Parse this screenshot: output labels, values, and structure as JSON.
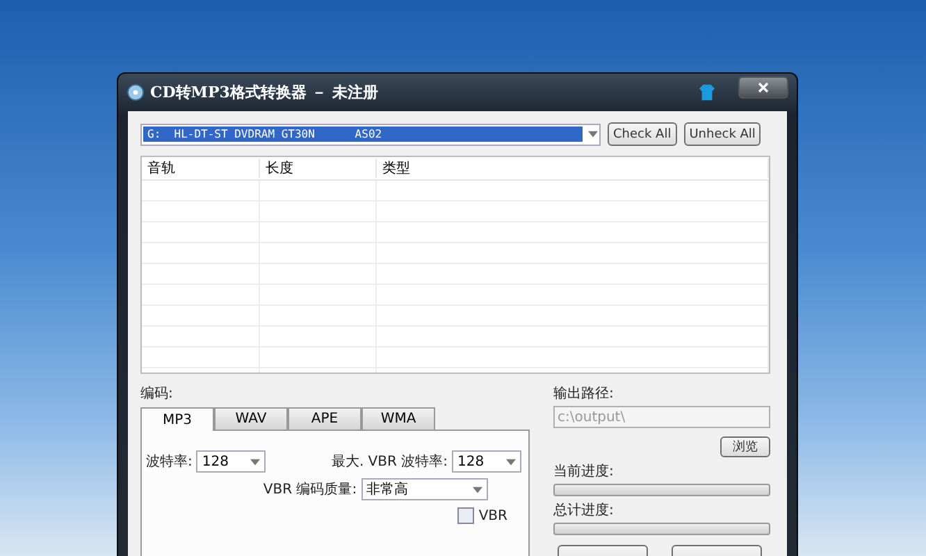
{
  "window": {
    "title": "CD转MP3格式转换器 － 未注册"
  },
  "drive_select": {
    "value": "G:  HL-DT-ST DVDRAM GT30N      AS02"
  },
  "buttons_top": [
    {
      "label": "Check All"
    },
    {
      "label": "Unheck All"
    }
  ],
  "table": {
    "columns": [
      "音轨",
      "长度",
      "类型"
    ]
  },
  "encoding": {
    "label": "编码:",
    "tabs": [
      {
        "label": "MP3",
        "selected": true
      },
      {
        "label": "WAV",
        "selected": false
      },
      {
        "label": "APE",
        "selected": false
      },
      {
        "label": "WMA",
        "selected": false
      }
    ],
    "bitrate": {
      "label": "波特率:",
      "value": "128"
    },
    "max_vbr_bitrate": {
      "label": "最大. VBR 波特率:",
      "value": "128"
    },
    "vbr_quality": {
      "label": "VBR 编码质量:",
      "value": "非常高"
    },
    "vbr": {
      "label": "VBR",
      "checked": false
    }
  },
  "output": {
    "label": "输出路径:",
    "placeholder": "c:\\output\\",
    "browse": "浏览"
  },
  "progress": [
    {
      "label": "当前进度:",
      "level": 0
    },
    {
      "label": "总计进度:",
      "level": 0
    }
  ]
}
